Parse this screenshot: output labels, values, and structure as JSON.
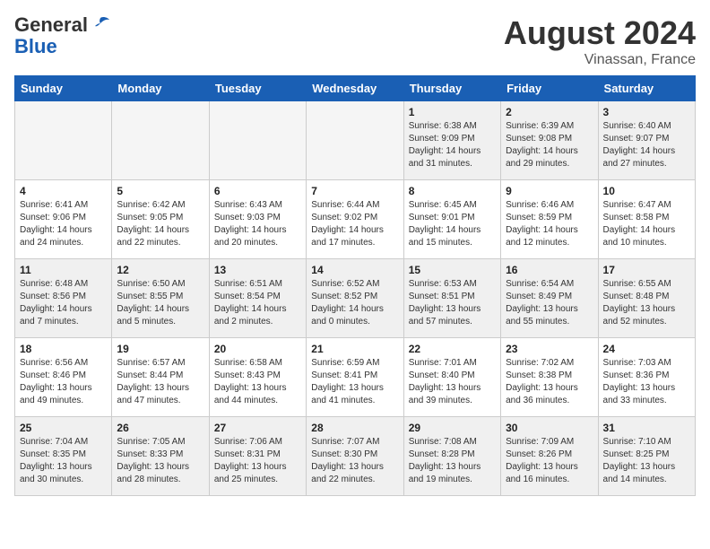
{
  "header": {
    "logo_line1": "General",
    "logo_line2": "Blue",
    "month": "August 2024",
    "location": "Vinassan, France"
  },
  "weekdays": [
    "Sunday",
    "Monday",
    "Tuesday",
    "Wednesday",
    "Thursday",
    "Friday",
    "Saturday"
  ],
  "weeks": [
    [
      {
        "day": "",
        "info": "",
        "empty": true
      },
      {
        "day": "",
        "info": "",
        "empty": true
      },
      {
        "day": "",
        "info": "",
        "empty": true
      },
      {
        "day": "",
        "info": "",
        "empty": true
      },
      {
        "day": "1",
        "info": "Sunrise: 6:38 AM\nSunset: 9:09 PM\nDaylight: 14 hours\nand 31 minutes."
      },
      {
        "day": "2",
        "info": "Sunrise: 6:39 AM\nSunset: 9:08 PM\nDaylight: 14 hours\nand 29 minutes."
      },
      {
        "day": "3",
        "info": "Sunrise: 6:40 AM\nSunset: 9:07 PM\nDaylight: 14 hours\nand 27 minutes."
      }
    ],
    [
      {
        "day": "4",
        "info": "Sunrise: 6:41 AM\nSunset: 9:06 PM\nDaylight: 14 hours\nand 24 minutes."
      },
      {
        "day": "5",
        "info": "Sunrise: 6:42 AM\nSunset: 9:05 PM\nDaylight: 14 hours\nand 22 minutes."
      },
      {
        "day": "6",
        "info": "Sunrise: 6:43 AM\nSunset: 9:03 PM\nDaylight: 14 hours\nand 20 minutes."
      },
      {
        "day": "7",
        "info": "Sunrise: 6:44 AM\nSunset: 9:02 PM\nDaylight: 14 hours\nand 17 minutes."
      },
      {
        "day": "8",
        "info": "Sunrise: 6:45 AM\nSunset: 9:01 PM\nDaylight: 14 hours\nand 15 minutes."
      },
      {
        "day": "9",
        "info": "Sunrise: 6:46 AM\nSunset: 8:59 PM\nDaylight: 14 hours\nand 12 minutes."
      },
      {
        "day": "10",
        "info": "Sunrise: 6:47 AM\nSunset: 8:58 PM\nDaylight: 14 hours\nand 10 minutes."
      }
    ],
    [
      {
        "day": "11",
        "info": "Sunrise: 6:48 AM\nSunset: 8:56 PM\nDaylight: 14 hours\nand 7 minutes."
      },
      {
        "day": "12",
        "info": "Sunrise: 6:50 AM\nSunset: 8:55 PM\nDaylight: 14 hours\nand 5 minutes."
      },
      {
        "day": "13",
        "info": "Sunrise: 6:51 AM\nSunset: 8:54 PM\nDaylight: 14 hours\nand 2 minutes."
      },
      {
        "day": "14",
        "info": "Sunrise: 6:52 AM\nSunset: 8:52 PM\nDaylight: 14 hours\nand 0 minutes."
      },
      {
        "day": "15",
        "info": "Sunrise: 6:53 AM\nSunset: 8:51 PM\nDaylight: 13 hours\nand 57 minutes."
      },
      {
        "day": "16",
        "info": "Sunrise: 6:54 AM\nSunset: 8:49 PM\nDaylight: 13 hours\nand 55 minutes."
      },
      {
        "day": "17",
        "info": "Sunrise: 6:55 AM\nSunset: 8:48 PM\nDaylight: 13 hours\nand 52 minutes."
      }
    ],
    [
      {
        "day": "18",
        "info": "Sunrise: 6:56 AM\nSunset: 8:46 PM\nDaylight: 13 hours\nand 49 minutes."
      },
      {
        "day": "19",
        "info": "Sunrise: 6:57 AM\nSunset: 8:44 PM\nDaylight: 13 hours\nand 47 minutes."
      },
      {
        "day": "20",
        "info": "Sunrise: 6:58 AM\nSunset: 8:43 PM\nDaylight: 13 hours\nand 44 minutes."
      },
      {
        "day": "21",
        "info": "Sunrise: 6:59 AM\nSunset: 8:41 PM\nDaylight: 13 hours\nand 41 minutes."
      },
      {
        "day": "22",
        "info": "Sunrise: 7:01 AM\nSunset: 8:40 PM\nDaylight: 13 hours\nand 39 minutes."
      },
      {
        "day": "23",
        "info": "Sunrise: 7:02 AM\nSunset: 8:38 PM\nDaylight: 13 hours\nand 36 minutes."
      },
      {
        "day": "24",
        "info": "Sunrise: 7:03 AM\nSunset: 8:36 PM\nDaylight: 13 hours\nand 33 minutes."
      }
    ],
    [
      {
        "day": "25",
        "info": "Sunrise: 7:04 AM\nSunset: 8:35 PM\nDaylight: 13 hours\nand 30 minutes."
      },
      {
        "day": "26",
        "info": "Sunrise: 7:05 AM\nSunset: 8:33 PM\nDaylight: 13 hours\nand 28 minutes."
      },
      {
        "day": "27",
        "info": "Sunrise: 7:06 AM\nSunset: 8:31 PM\nDaylight: 13 hours\nand 25 minutes."
      },
      {
        "day": "28",
        "info": "Sunrise: 7:07 AM\nSunset: 8:30 PM\nDaylight: 13 hours\nand 22 minutes."
      },
      {
        "day": "29",
        "info": "Sunrise: 7:08 AM\nSunset: 8:28 PM\nDaylight: 13 hours\nand 19 minutes."
      },
      {
        "day": "30",
        "info": "Sunrise: 7:09 AM\nSunset: 8:26 PM\nDaylight: 13 hours\nand 16 minutes."
      },
      {
        "day": "31",
        "info": "Sunrise: 7:10 AM\nSunset: 8:25 PM\nDaylight: 13 hours\nand 14 minutes."
      }
    ]
  ]
}
